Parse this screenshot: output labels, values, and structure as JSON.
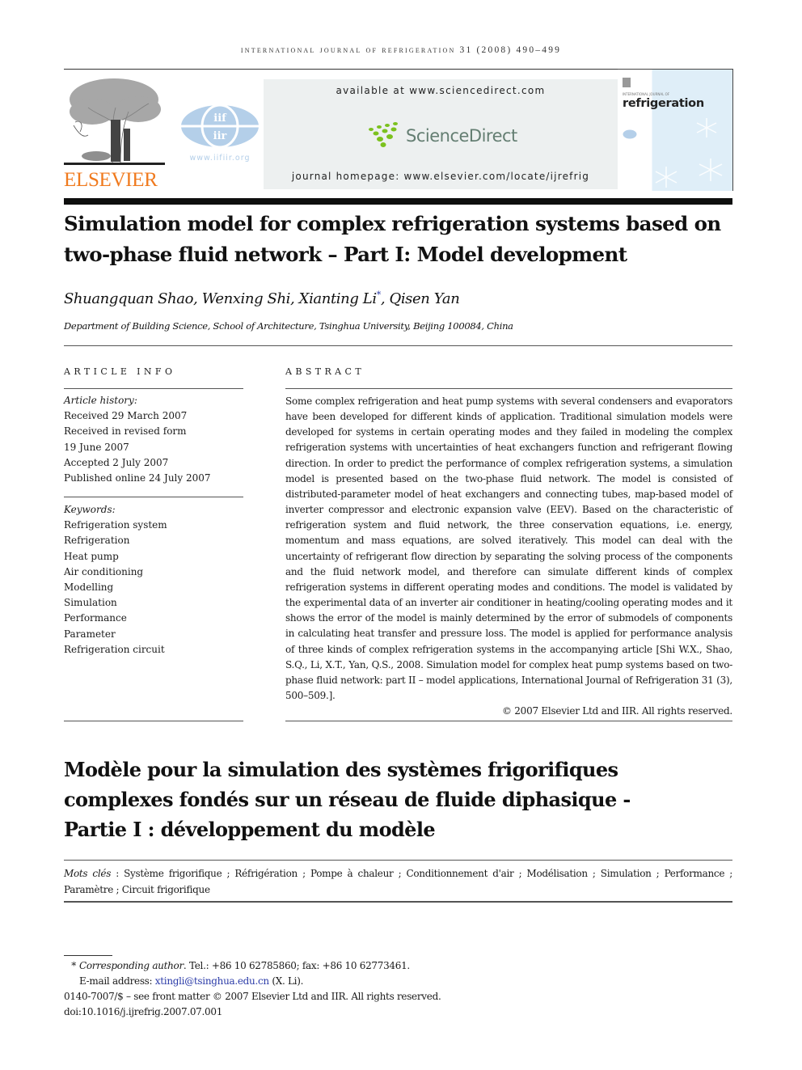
{
  "running_head": "INTERNATIONAL JOURNAL OF REFRIGERATION 31 (2008) 490–499",
  "header": {
    "publisher_logo_text": "ELSEVIER",
    "iif_logo_text": "iif iir",
    "iif_url": "www.iifiir.org",
    "available_at": "available at www.sciencedirect.com",
    "sciencedirect_brand": "ScienceDirect",
    "journal_homepage": "journal homepage: www.elsevier.com/locate/ijrefrig",
    "cover": {
      "small_top": "INTERNATIONAL JOURNAL OF",
      "title": "refrigeration"
    },
    "colors": {
      "elsevier_orange": "#f07a1e",
      "iif_blue": "#b4cfe9",
      "sciencedirect_green": "#7bc11e",
      "sciencedirect_text": "#647e72",
      "banner_bg": "#edf0f0",
      "link_blue": "#2b3ba8"
    }
  },
  "article": {
    "title_line1": "Simulation model for complex refrigeration systems based on",
    "title_line2": "two-phase fluid network – Part I: Model development",
    "authors": [
      {
        "name": "Shuangquan Shao",
        "corresponding": false
      },
      {
        "name": "Wenxing Shi",
        "corresponding": false
      },
      {
        "name": "Xianting Li",
        "corresponding": true
      },
      {
        "name": "Qisen Yan",
        "corresponding": false
      }
    ],
    "authors_sep": ", ",
    "corresponding_mark": "*",
    "affiliation": "Department of Building Science, School of Architecture, Tsinghua University, Beijing 100084, China"
  },
  "article_info": {
    "heading": "ARTICLE INFO",
    "history_label": "Article history:",
    "history": [
      "Received 29 March 2007",
      "Received in revised form",
      "19 June 2007",
      "Accepted 2 July 2007",
      "Published online 24 July 2007"
    ],
    "keywords_label": "Keywords:",
    "keywords": [
      "Refrigeration system",
      "Refrigeration",
      "Heat pump",
      "Air conditioning",
      "Modelling",
      "Simulation",
      "Performance",
      "Parameter",
      "Refrigeration circuit"
    ]
  },
  "abstract": {
    "heading": "ABSTRACT",
    "text": "Some complex refrigeration and heat pump systems with several condensers and evaporators have been developed for different kinds of application. Traditional simulation models were developed for systems in certain operating modes and they failed in modeling the complex refrigeration systems with uncertainties of heat exchangers function and refrigerant flowing direction. In order to predict the performance of complex refrigeration systems, a simulation model is presented based on the two-phase fluid network. The model is consisted of distributed-parameter model of heat exchangers and connecting tubes, map-based model of inverter compressor and electronic expansion valve (EEV). Based on the characteristic of refrigeration system and fluid network, the three conservation equations, i.e. energy, momentum and mass equations, are solved iteratively. This model can deal with the uncertainty of refrigerant flow direction by separating the solving process of the components and the fluid network model, and therefore can simulate different kinds of complex refrigeration systems in different operating modes and conditions. The model is validated by the experimental data of an inverter air conditioner in heating/cooling operating modes and it shows the error of the model is mainly determined by the error of submodels of components in calculating heat transfer and pressure loss. The model is applied for performance analysis of three kinds of complex refrigeration systems in the accompanying article [Shi W.X., Shao, S.Q., Li, X.T., Yan, Q.S., 2008. Simulation model for complex heat pump systems based on two-phase fluid network: part II – model applications, International Journal of Refrigeration 31 (3), 500–509.].",
    "copyright": "© 2007 Elsevier Ltd and IIR. All rights reserved."
  },
  "french": {
    "title_line1": "Modèle pour la simulation des systèmes frigorifiques",
    "title_line2": "complexes fondés sur un réseau de fluide diphasique -",
    "title_line3": "Partie I : développement du modèle",
    "mots_label": "Mots clés",
    "mots_sep": " : ",
    "mots_cles": "Système frigorifique ; Réfrigération ; Pompe à chaleur ; Conditionnement d'air ; Modélisation ; Simulation ; Performance ; Paramètre ; Circuit frigorifique"
  },
  "footnotes": {
    "star": "*",
    "corresponding_label": "Corresponding author",
    "contact": ". Tel.: +86 10 62785860; fax: +86 10 62773461.",
    "email_label": "E-mail address: ",
    "email": "xtingli@tsinghua.edu.cn",
    "email_suffix": " (X. Li).",
    "front_matter": "0140-7007/$ – see front matter © 2007 Elsevier Ltd and IIR. All rights reserved.",
    "doi": "doi:10.1016/j.ijrefrig.2007.07.001"
  }
}
